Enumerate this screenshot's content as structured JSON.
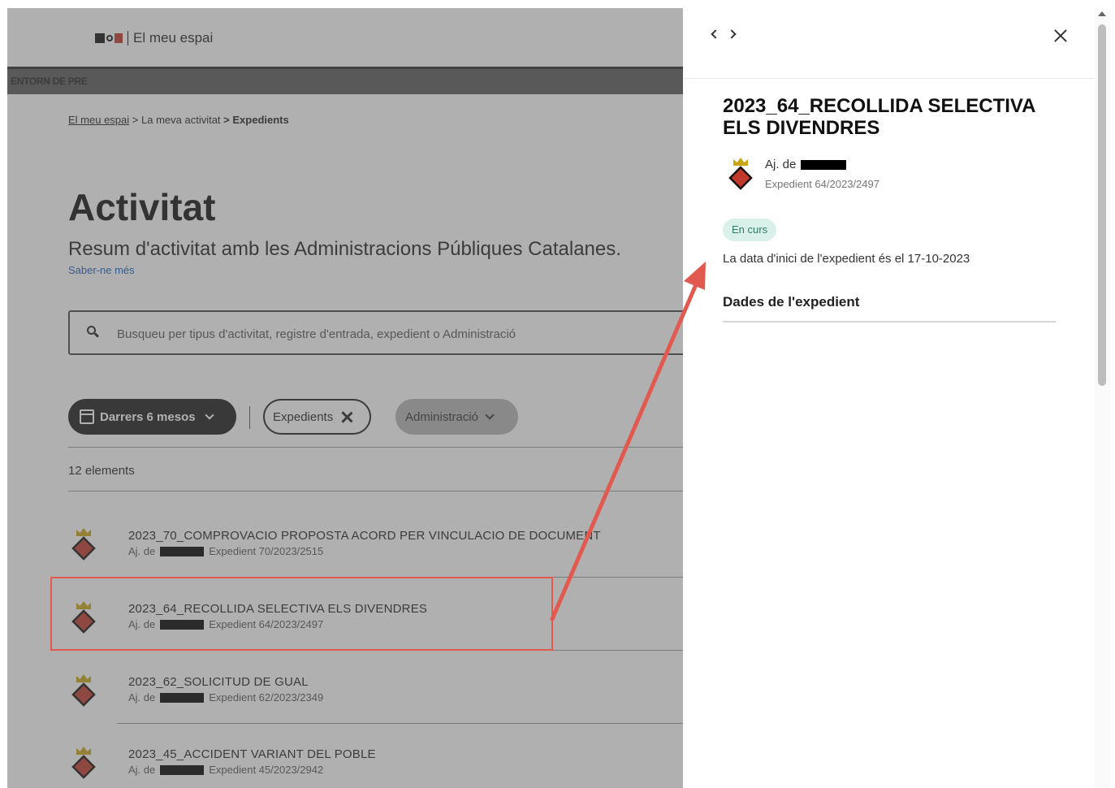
{
  "header": {
    "app_title": "El meu espai"
  },
  "environment_label": "ENTORN DE PRE",
  "breadcrumb": {
    "items": [
      "El meu espai",
      "La meva activitat",
      "Expedients"
    ],
    "separator": ">"
  },
  "page": {
    "title": "Activitat",
    "lead": "Resum d'activitat amb les Administracions Públiques Catalanes.",
    "more_link": "Saber-ne més"
  },
  "search": {
    "placeholder": "Busqueu per tipus d'activitat, registre d'entrada, expedient o Administració",
    "icon": "search-icon"
  },
  "filters": {
    "date": "Darrers 6 mesos",
    "type": "Expedients",
    "admin": "Administració"
  },
  "results_count": "12 elements",
  "rows": [
    {
      "title": "2023_70_COMPROVACIO PROPOSTA ACORD PER VINCULACIO DE DOCUMENT",
      "org": "Aj. de",
      "expedient": "Expedient 70/2023/2515"
    },
    {
      "title": "2023_64_RECOLLIDA SELECTIVA ELS DIVENDRES",
      "org": "Aj. de",
      "expedient": "Expedient 64/2023/2497"
    },
    {
      "title": "2023_62_SOLICITUD DE GUAL",
      "org": "Aj. de",
      "expedient": "Expedient 62/2023/2349"
    },
    {
      "title": "2023_45_ACCIDENT VARIANT DEL POBLE",
      "org": "Aj. de",
      "expedient": "Expedient 45/2023/2942"
    }
  ],
  "panel": {
    "title": "2023_64_RECOLLIDA SELECTIVA ELS DIVENDRES",
    "org": "Aj. de",
    "expedient": "Expedient 64/2023/2497",
    "status": "En curs",
    "start_text": "La data d'inici de l'expedient és el 17-10-2023",
    "section": "Dades de l'expedient"
  },
  "colors": {
    "annotation": "#e25a4f",
    "badge_bg": "#d9f1ea",
    "badge_text": "#2e7c66",
    "link": "#1a5fb4"
  }
}
